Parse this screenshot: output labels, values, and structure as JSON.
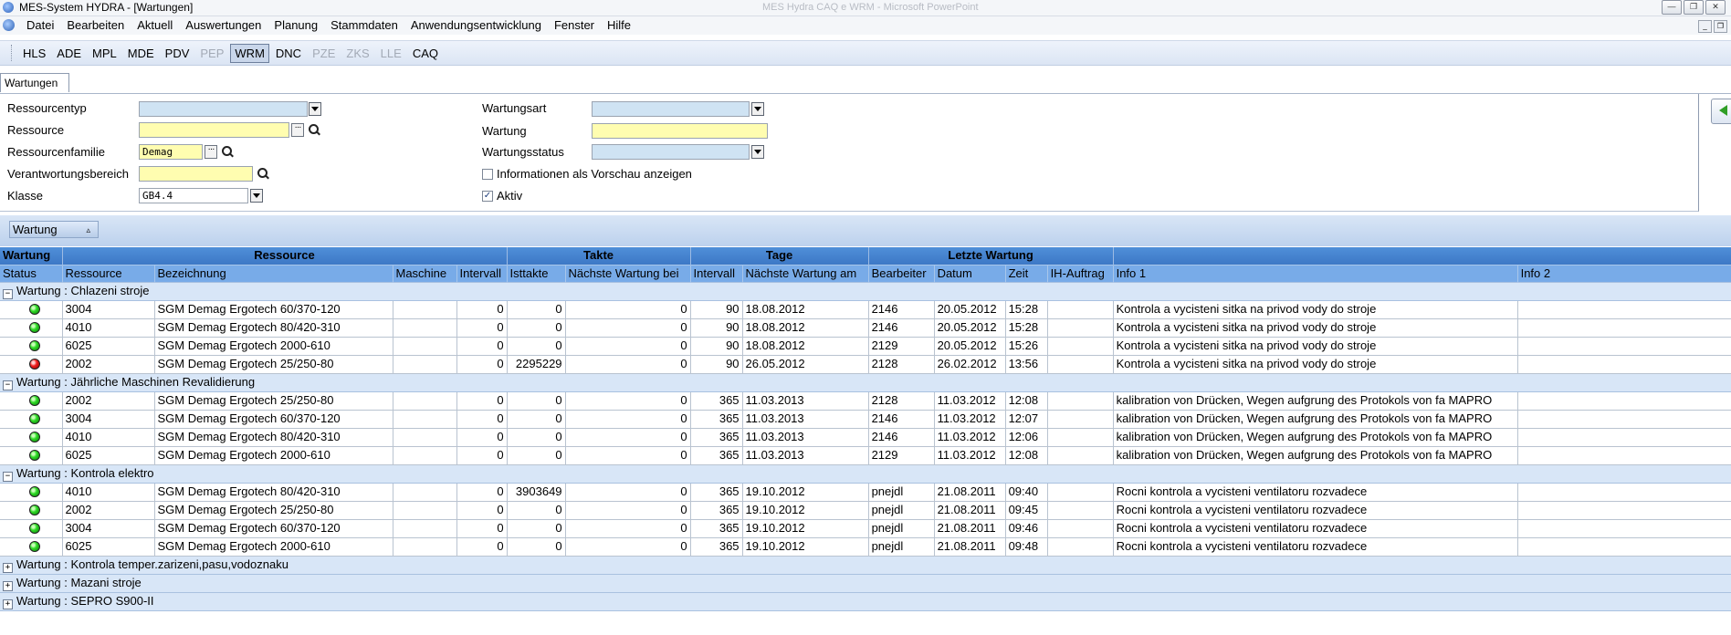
{
  "window": {
    "title": "MES-System HYDRA - [Wartungen]",
    "background_title": "MES Hydra CAQ e WRM - Microsoft PowerPoint",
    "controls": [
      "—",
      "❐",
      "✕"
    ],
    "mdi_controls": [
      "_",
      "❐"
    ]
  },
  "menu": [
    "Datei",
    "Bearbeiten",
    "Aktuell",
    "Auswertungen",
    "Planung",
    "Stammdaten",
    "Anwendungsentwicklung",
    "Fenster",
    "Hilfe"
  ],
  "modules": [
    {
      "label": "HLS",
      "state": "enabled"
    },
    {
      "label": "ADE",
      "state": "enabled"
    },
    {
      "label": "MPL",
      "state": "enabled"
    },
    {
      "label": "MDE",
      "state": "enabled"
    },
    {
      "label": "PDV",
      "state": "enabled"
    },
    {
      "label": "PEP",
      "state": "disabled"
    },
    {
      "label": "WRM",
      "state": "active"
    },
    {
      "label": "DNC",
      "state": "enabled"
    },
    {
      "label": "PZE",
      "state": "disabled"
    },
    {
      "label": "ZKS",
      "state": "disabled"
    },
    {
      "label": "LLE",
      "state": "disabled"
    },
    {
      "label": "CAQ",
      "state": "enabled"
    }
  ],
  "tab": {
    "label": "Wartungen"
  },
  "filter": {
    "ressourcentyp": {
      "label": "Ressourcentyp",
      "value": ""
    },
    "ressource": {
      "label": "Ressource",
      "value": ""
    },
    "ressourcenfamilie": {
      "label": "Ressourcenfamilie",
      "value": "Demag"
    },
    "verantwortungsbereich": {
      "label": "Verantwortungsbereich",
      "value": ""
    },
    "klasse": {
      "label": "Klasse",
      "value": "GB4.4"
    },
    "wartungsart": {
      "label": "Wartungsart",
      "value": ""
    },
    "wartung": {
      "label": "Wartung",
      "value": ""
    },
    "wartungsstatus": {
      "label": "Wartungsstatus",
      "value": ""
    },
    "vorschau": {
      "label": "Informationen als Vorschau anzeigen",
      "checked": false
    },
    "aktiv": {
      "label": "Aktiv",
      "checked": true,
      "mark": "✓"
    }
  },
  "groupby": {
    "label": "Wartung",
    "sort_glyph": "▵"
  },
  "grid": {
    "header1": {
      "wartung": "Wartung",
      "ressource": "Ressource",
      "takte": "Takte",
      "tage": "Tage",
      "letzte": "Letzte Wartung"
    },
    "columns": [
      "Status",
      "Ressource",
      "Bezeichnung",
      "Maschine",
      "Intervall",
      "Isttakte",
      "Nächste Wartung bei",
      "Intervall",
      "Nächste Wartung am",
      "Bearbeiter",
      "Datum",
      "Zeit",
      "IH-Auftrag",
      "Info 1",
      "Info 2"
    ],
    "groups": [
      {
        "label": "Wartung : Chlazeni stroje",
        "expanded": true,
        "toggle": "−",
        "rows": [
          {
            "status": "green",
            "ressource": "3004",
            "bezeichnung": "SGM Demag Ergotech 60/370-120",
            "maschine": "",
            "intervall": "0",
            "isttakte": "0",
            "naechste_bei": "0",
            "tage_intervall": "90",
            "naechste_am": "18.08.2012",
            "bearbeiter": "2146",
            "datum": "20.05.2012",
            "zeit": "15:28",
            "ih_auftrag": "",
            "info1": "Kontrola a vycisteni sitka na privod vody do stroje",
            "info2": ""
          },
          {
            "status": "green",
            "ressource": "4010",
            "bezeichnung": "SGM Demag Ergotech 80/420-310",
            "maschine": "",
            "intervall": "0",
            "isttakte": "0",
            "naechste_bei": "0",
            "tage_intervall": "90",
            "naechste_am": "18.08.2012",
            "bearbeiter": "2146",
            "datum": "20.05.2012",
            "zeit": "15:28",
            "ih_auftrag": "",
            "info1": "Kontrola a vycisteni sitka na privod vody do stroje",
            "info2": ""
          },
          {
            "status": "green",
            "ressource": "6025",
            "bezeichnung": "SGM Demag Ergotech 2000-610",
            "maschine": "",
            "intervall": "0",
            "isttakte": "0",
            "naechste_bei": "0",
            "tage_intervall": "90",
            "naechste_am": "18.08.2012",
            "bearbeiter": "2129",
            "datum": "20.05.2012",
            "zeit": "15:26",
            "ih_auftrag": "",
            "info1": "Kontrola a vycisteni sitka na privod vody do stroje",
            "info2": ""
          },
          {
            "status": "red",
            "ressource": "2002",
            "bezeichnung": "SGM Demag Ergotech 25/250-80",
            "maschine": "",
            "intervall": "0",
            "isttakte": "2295229",
            "naechste_bei": "0",
            "tage_intervall": "90",
            "naechste_am": "26.05.2012",
            "bearbeiter": "2128",
            "datum": "26.02.2012",
            "zeit": "13:56",
            "ih_auftrag": "",
            "info1": "Kontrola a vycisteni sitka na privod vody do stroje",
            "info2": ""
          }
        ]
      },
      {
        "label": "Wartung : Jährliche Maschinen Revalidierung",
        "expanded": true,
        "toggle": "−",
        "rows": [
          {
            "status": "green",
            "ressource": "2002",
            "bezeichnung": "SGM Demag Ergotech 25/250-80",
            "maschine": "",
            "intervall": "0",
            "isttakte": "0",
            "naechste_bei": "0",
            "tage_intervall": "365",
            "naechste_am": "11.03.2013",
            "bearbeiter": "2128",
            "datum": "11.03.2012",
            "zeit": "12:08",
            "ih_auftrag": "",
            "info1": "kalibration von Drücken, Wegen aufgrung des Protokols von fa MAPRO",
            "info2": ""
          },
          {
            "status": "green",
            "ressource": "3004",
            "bezeichnung": "SGM Demag Ergotech 60/370-120",
            "maschine": "",
            "intervall": "0",
            "isttakte": "0",
            "naechste_bei": "0",
            "tage_intervall": "365",
            "naechste_am": "11.03.2013",
            "bearbeiter": "2146",
            "datum": "11.03.2012",
            "zeit": "12:07",
            "ih_auftrag": "",
            "info1": "kalibration von Drücken, Wegen aufgrung des Protokols von fa MAPRO",
            "info2": ""
          },
          {
            "status": "green",
            "ressource": "4010",
            "bezeichnung": "SGM Demag Ergotech 80/420-310",
            "maschine": "",
            "intervall": "0",
            "isttakte": "0",
            "naechste_bei": "0",
            "tage_intervall": "365",
            "naechste_am": "11.03.2013",
            "bearbeiter": "2146",
            "datum": "11.03.2012",
            "zeit": "12:06",
            "ih_auftrag": "",
            "info1": "kalibration von Drücken, Wegen aufgrung des Protokols von fa MAPRO",
            "info2": ""
          },
          {
            "status": "green",
            "ressource": "6025",
            "bezeichnung": "SGM Demag Ergotech 2000-610",
            "maschine": "",
            "intervall": "0",
            "isttakte": "0",
            "naechste_bei": "0",
            "tage_intervall": "365",
            "naechste_am": "11.03.2013",
            "bearbeiter": "2129",
            "datum": "11.03.2012",
            "zeit": "12:08",
            "ih_auftrag": "",
            "info1": "kalibration von Drücken, Wegen aufgrung des Protokols von fa MAPRO",
            "info2": ""
          }
        ]
      },
      {
        "label": "Wartung : Kontrola elektro",
        "expanded": true,
        "toggle": "−",
        "rows": [
          {
            "status": "green",
            "ressource": "4010",
            "bezeichnung": "SGM Demag Ergotech 80/420-310",
            "maschine": "",
            "intervall": "0",
            "isttakte": "3903649",
            "naechste_bei": "0",
            "tage_intervall": "365",
            "naechste_am": "19.10.2012",
            "bearbeiter": "pnejdl",
            "datum": "21.08.2011",
            "zeit": "09:40",
            "ih_auftrag": "",
            "info1": "Rocni kontrola a vycisteni ventilatoru rozvadece",
            "info2": ""
          },
          {
            "status": "green",
            "ressource": "2002",
            "bezeichnung": "SGM Demag Ergotech 25/250-80",
            "maschine": "",
            "intervall": "0",
            "isttakte": "0",
            "naechste_bei": "0",
            "tage_intervall": "365",
            "naechste_am": "19.10.2012",
            "bearbeiter": "pnejdl",
            "datum": "21.08.2011",
            "zeit": "09:45",
            "ih_auftrag": "",
            "info1": "Rocni kontrola a vycisteni ventilatoru rozvadece",
            "info2": ""
          },
          {
            "status": "green",
            "ressource": "3004",
            "bezeichnung": "SGM Demag Ergotech 60/370-120",
            "maschine": "",
            "intervall": "0",
            "isttakte": "0",
            "naechste_bei": "0",
            "tage_intervall": "365",
            "naechste_am": "19.10.2012",
            "bearbeiter": "pnejdl",
            "datum": "21.08.2011",
            "zeit": "09:46",
            "ih_auftrag": "",
            "info1": "Rocni kontrola a vycisteni ventilatoru rozvadece",
            "info2": ""
          },
          {
            "status": "green",
            "ressource": "6025",
            "bezeichnung": "SGM Demag Ergotech 2000-610",
            "maschine": "",
            "intervall": "0",
            "isttakte": "0",
            "naechste_bei": "0",
            "tage_intervall": "365",
            "naechste_am": "19.10.2012",
            "bearbeiter": "pnejdl",
            "datum": "21.08.2011",
            "zeit": "09:48",
            "ih_auftrag": "",
            "info1": "Rocni kontrola a vycisteni ventilatoru rozvadece",
            "info2": ""
          }
        ]
      },
      {
        "label": "Wartung : Kontrola temper.zarizeni,pasu,vodoznaku",
        "expanded": false,
        "toggle": "+",
        "rows": []
      },
      {
        "label": "Wartung : Mazani stroje",
        "expanded": false,
        "toggle": "+",
        "rows": []
      },
      {
        "label": "Wartung : SEPRO S900-II",
        "expanded": false,
        "toggle": "+",
        "rows": []
      }
    ]
  }
}
